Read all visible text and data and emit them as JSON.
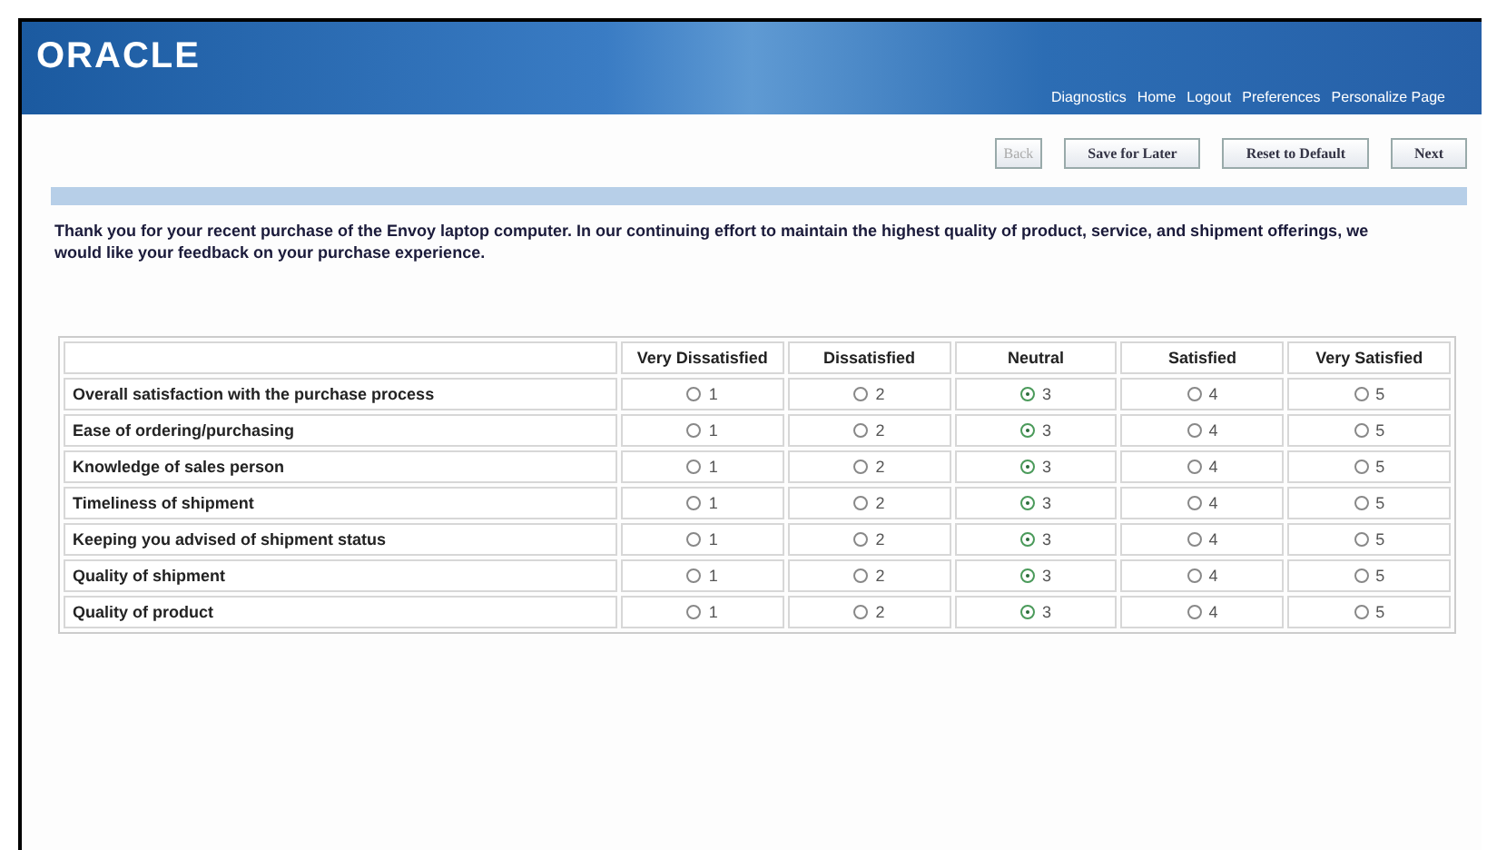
{
  "header": {
    "logo": "ORACLE",
    "links": [
      "Diagnostics",
      "Home",
      "Logout",
      "Preferences",
      "Personalize Page"
    ]
  },
  "buttons": [
    {
      "label": "Back",
      "disabled": true
    },
    {
      "label": "Save for Later",
      "disabled": false
    },
    {
      "label": "Reset to Default",
      "disabled": false
    },
    {
      "label": "Next",
      "disabled": false
    }
  ],
  "intro": "Thank you for your recent purchase of the Envoy laptop computer. In our continuing effort to maintain the highest quality of product, service, and shipment offerings, we would like your feedback on your purchase experience.",
  "table": {
    "columns": [
      "Very Dissatisfied",
      "Dissatisfied",
      "Neutral",
      "Satisfied",
      "Very Satisfied"
    ],
    "rows": [
      {
        "label": "Overall satisfaction with the purchase process",
        "options": [
          {
            "value": "1",
            "selected": false
          },
          {
            "value": "2",
            "selected": false
          },
          {
            "value": "3",
            "selected": true
          },
          {
            "value": "4",
            "selected": false
          },
          {
            "value": "5",
            "selected": false
          }
        ]
      },
      {
        "label": "Ease of ordering/purchasing",
        "options": [
          {
            "value": "1",
            "selected": false
          },
          {
            "value": "2",
            "selected": false
          },
          {
            "value": "3",
            "selected": true
          },
          {
            "value": "4",
            "selected": false
          },
          {
            "value": "5",
            "selected": false
          }
        ]
      },
      {
        "label": "Knowledge of sales person",
        "options": [
          {
            "value": "1",
            "selected": false
          },
          {
            "value": "2",
            "selected": false
          },
          {
            "value": "3",
            "selected": true
          },
          {
            "value": "4",
            "selected": false
          },
          {
            "value": "5",
            "selected": false
          }
        ]
      },
      {
        "label": "Timeliness of shipment",
        "options": [
          {
            "value": "1",
            "selected": false
          },
          {
            "value": "2",
            "selected": false
          },
          {
            "value": "3",
            "selected": true
          },
          {
            "value": "4",
            "selected": false
          },
          {
            "value": "5",
            "selected": false
          }
        ]
      },
      {
        "label": "Keeping you advised of shipment status",
        "options": [
          {
            "value": "1",
            "selected": false
          },
          {
            "value": "2",
            "selected": false
          },
          {
            "value": "3",
            "selected": true
          },
          {
            "value": "4",
            "selected": false
          },
          {
            "value": "5",
            "selected": false
          }
        ]
      },
      {
        "label": "Quality of shipment",
        "options": [
          {
            "value": "1",
            "selected": false
          },
          {
            "value": "2",
            "selected": false
          },
          {
            "value": "3",
            "selected": true
          },
          {
            "value": "4",
            "selected": false
          },
          {
            "value": "5",
            "selected": false
          }
        ]
      },
      {
        "label": "Quality of product",
        "options": [
          {
            "value": "1",
            "selected": false
          },
          {
            "value": "2",
            "selected": false
          },
          {
            "value": "3",
            "selected": true
          },
          {
            "value": "4",
            "selected": false
          },
          {
            "value": "5",
            "selected": false
          }
        ]
      }
    ]
  }
}
